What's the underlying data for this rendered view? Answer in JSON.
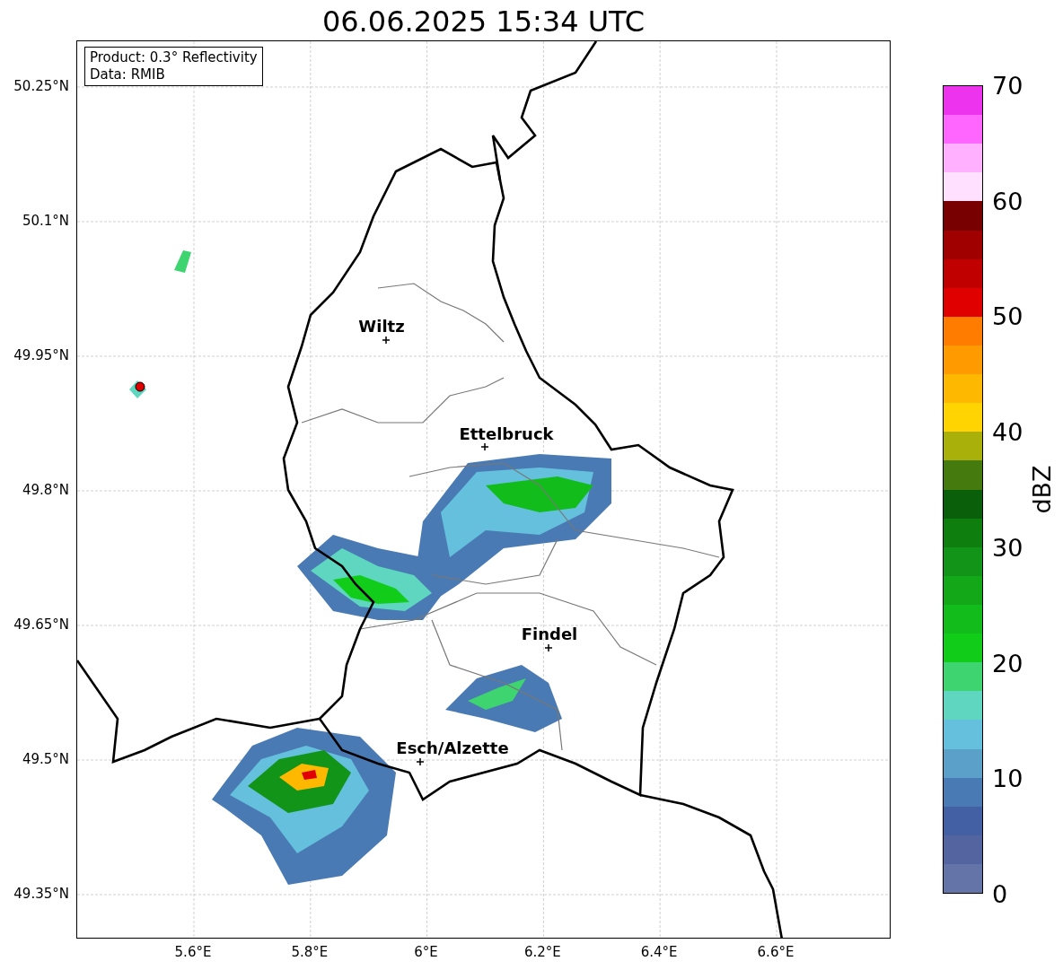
{
  "title": "06.06.2025 15:34 UTC",
  "info_box": {
    "lines": [
      "Product: 0.3° Reflectivity",
      "Data: RMIB"
    ]
  },
  "map": {
    "places": [
      {
        "name": "Wiltz"
      },
      {
        "name": "Ettelbruck"
      },
      {
        "name": "Findel"
      },
      {
        "name": "Esch/Alzette"
      }
    ]
  },
  "y_axis": {
    "ticks": [
      "50.25°N",
      "50.1°N",
      "49.95°N",
      "49.8°N",
      "49.65°N",
      "49.5°N",
      "49.35°N"
    ]
  },
  "x_axis": {
    "ticks": [
      "5.6°E",
      "5.8°E",
      "6°E",
      "6.2°E",
      "6.4°E",
      "6.6°E"
    ]
  },
  "colorbar": {
    "label": "dBZ",
    "ticks": [
      "70",
      "60",
      "50",
      "40",
      "30",
      "20",
      "10",
      "0"
    ],
    "segments": [
      {
        "color": "#ee33ee"
      },
      {
        "color": "#ff66ff"
      },
      {
        "color": "#ffb0ff"
      },
      {
        "color": "#ffe0ff"
      },
      {
        "color": "#780000"
      },
      {
        "color": "#a00000"
      },
      {
        "color": "#c00000"
      },
      {
        "color": "#e00000"
      },
      {
        "color": "#ff7c00"
      },
      {
        "color": "#ff9a00"
      },
      {
        "color": "#ffb800"
      },
      {
        "color": "#ffd400"
      },
      {
        "color": "#aab00a"
      },
      {
        "color": "#447a0e"
      },
      {
        "color": "#0a600a"
      },
      {
        "color": "#0e7e0e"
      },
      {
        "color": "#129418"
      },
      {
        "color": "#12a818"
      },
      {
        "color": "#12bc1a"
      },
      {
        "color": "#12cc1a"
      },
      {
        "color": "#3ed470"
      },
      {
        "color": "#5ed6c0"
      },
      {
        "color": "#64c0dc"
      },
      {
        "color": "#5aa0c8"
      },
      {
        "color": "#4a7ab4"
      },
      {
        "color": "#4460a4"
      },
      {
        "color": "#5464a0"
      },
      {
        "color": "#6474a8"
      }
    ]
  }
}
